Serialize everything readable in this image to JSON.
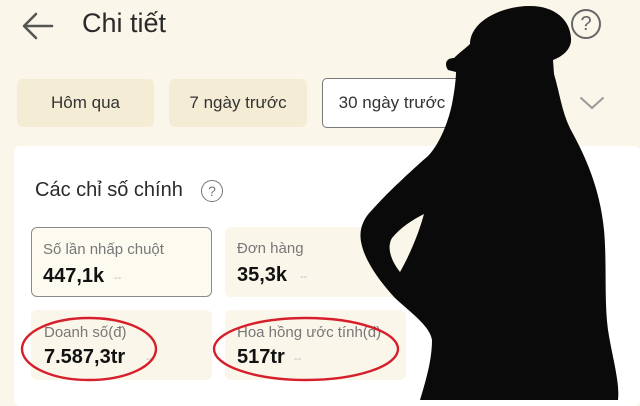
{
  "header": {
    "title": "Chi tiết",
    "help_glyph": "?"
  },
  "tabs": [
    {
      "label": "Hôm qua",
      "active": false
    },
    {
      "label": "7 ngày trước",
      "active": false
    },
    {
      "label": "30 ngày trước",
      "active": true
    }
  ],
  "section": {
    "title": "Các chỉ số chính",
    "info_glyph": "?"
  },
  "metrics": [
    {
      "label": "Số lần nhấp chuột",
      "value": "447,1k",
      "change": "--"
    },
    {
      "label": "Đơn hàng",
      "value": "35,3k",
      "change": "--"
    },
    {
      "label": "Doanh số(đ)",
      "value": "7.587,3tr",
      "change": "--"
    },
    {
      "label": "Hoa hồng ước tính(đ)",
      "value": "517tr",
      "change": "--"
    }
  ],
  "colors": {
    "background": "#fbf6ea",
    "annotation": "#d61f2b",
    "silhouette": "#0a0a0a"
  }
}
